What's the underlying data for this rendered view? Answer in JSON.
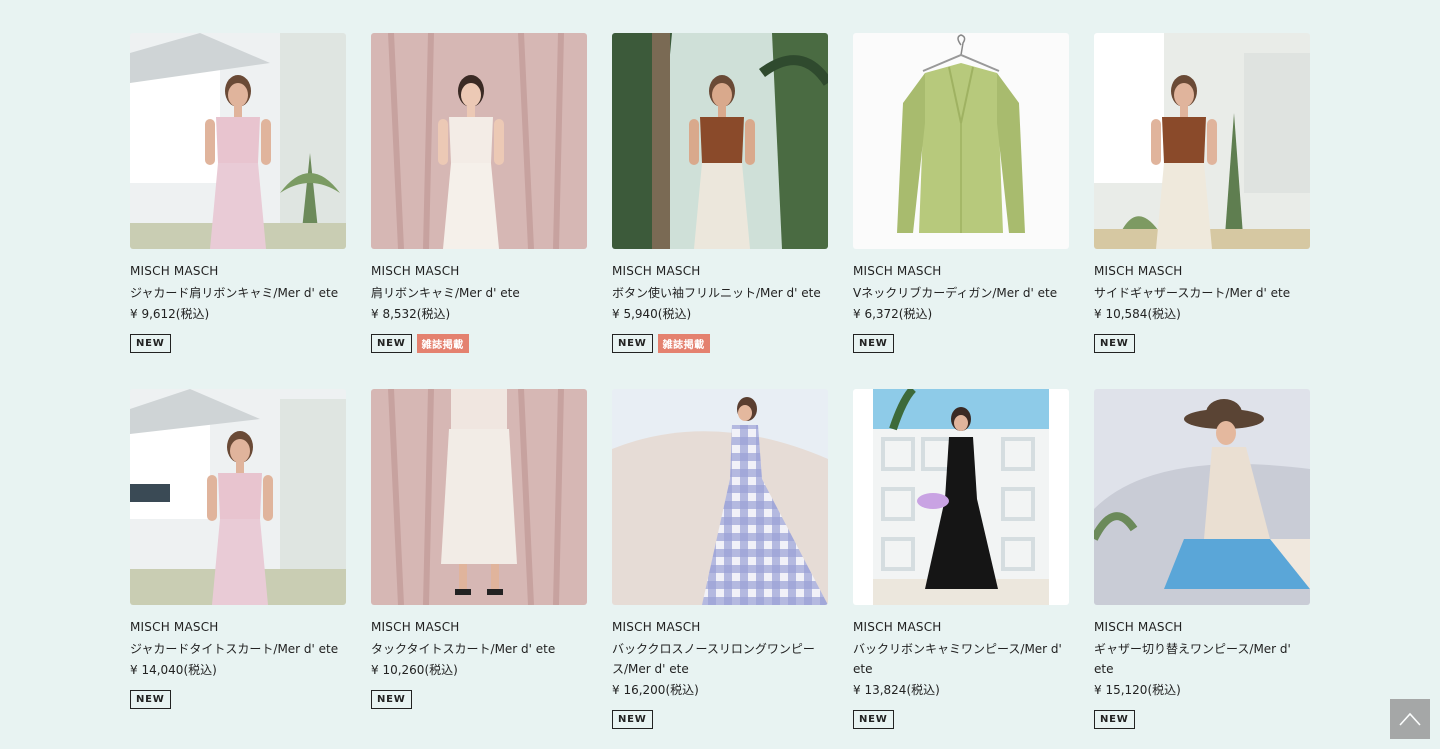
{
  "products": [
    {
      "brand": "MISCH MASCH",
      "name": "ジャカード肩リボンキャミ/Mer d' ete",
      "price": "¥ 9,612(税込)",
      "badge_new": "NEW",
      "badge_mag": "",
      "scene": "garden-floral-dress"
    },
    {
      "brand": "MISCH MASCH",
      "name": "肩リボンキャミ/Mer d' ete",
      "price": "¥ 8,532(税込)",
      "badge_new": "NEW",
      "badge_mag": "雑誌掲載",
      "scene": "pink-curtain-white-top"
    },
    {
      "brand": "MISCH MASCH",
      "name": "ボタン使い袖フリルニット/Mer d' ete",
      "price": "¥ 5,940(税込)",
      "badge_new": "NEW",
      "badge_mag": "雑誌掲載",
      "scene": "palm-brown-knit"
    },
    {
      "brand": "MISCH MASCH",
      "name": "Vネックリブカーディガン/Mer d' ete",
      "price": "¥ 6,372(税込)",
      "badge_new": "NEW",
      "badge_mag": "",
      "scene": "green-cardigan-hanger"
    },
    {
      "brand": "MISCH MASCH",
      "name": "サイドギャザースカート/Mer d' ete",
      "price": "¥ 10,584(税込)",
      "badge_new": "NEW",
      "badge_mag": "",
      "scene": "garden-brown-top-skirt"
    },
    {
      "brand": "MISCH MASCH",
      "name": "ジャカードタイトスカート/Mer d' ete",
      "price": "¥ 14,040(税込)",
      "badge_new": "NEW",
      "badge_mag": "",
      "scene": "garden-floral-skirt"
    },
    {
      "brand": "MISCH MASCH",
      "name": "タックタイトスカート/Mer d' ete",
      "price": "¥ 10,260(税込)",
      "badge_new": "NEW",
      "badge_mag": "",
      "scene": "pink-curtain-skirt"
    },
    {
      "brand": "MISCH MASCH",
      "name": "バッククロスノースリロングワンピース/Mer d' ete",
      "price": "¥ 16,200(税込)",
      "badge_new": "NEW",
      "badge_mag": "",
      "scene": "gingham-dress"
    },
    {
      "brand": "MISCH MASCH",
      "name": "バックリボンキャミワンピース/Mer d' ete",
      "price": "¥ 13,824(税込)",
      "badge_new": "NEW",
      "badge_mag": "",
      "scene": "black-dress-wall"
    },
    {
      "brand": "MISCH MASCH",
      "name": "ギャザー切り替えワンピース/Mer d' ete",
      "price": "¥ 15,120(税込)",
      "badge_new": "NEW",
      "badge_mag": "",
      "scene": "hat-blue-skirt"
    }
  ],
  "colors": {
    "background": "#e8f3f2",
    "badge_magazine": "#e4816f",
    "to_top": "#9a9a9a"
  },
  "scroll_top_icon": "chevron-up-icon"
}
